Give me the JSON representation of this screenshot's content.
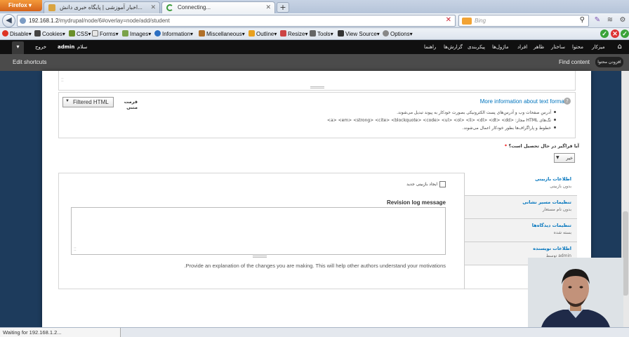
{
  "browser": {
    "app_button": "Firefox",
    "tabs": [
      {
        "label": "اخبار آموزشی | پایگاه خبری دانش...",
        "active": false
      },
      {
        "label": "Connecting...",
        "active": true
      }
    ],
    "url_host": "192.168.1.2",
    "url_path": "/mydrupal/node/6#overlay=node/add/student",
    "search_placeholder": "Bing",
    "status": "Waiting for 192.168.1.2..."
  },
  "devbar": {
    "items": [
      "Disable",
      "Cookies",
      "CSS",
      "Forms",
      "Images",
      "Information",
      "Miscellaneous",
      "Outline",
      "Resize",
      "Tools",
      "View Source",
      "Options"
    ]
  },
  "drupal": {
    "menu": [
      "میزکار",
      "محتوا",
      "ساختار",
      "ظاهر",
      "افراد",
      "ماژول‌ها",
      "پیکربندی",
      "گزارش‌ها",
      "راهنما"
    ],
    "user_greeting": "سلام",
    "user_name": "admin",
    "logout": "خروج",
    "edit_shortcuts": "Edit shortcuts",
    "find_content": "Find content",
    "add_content": "افزودن محتوا"
  },
  "form": {
    "format_label": "قرمت متنی",
    "format_value": "Filtered HTML",
    "more_info": "More information about text formats",
    "tips": [
      "آدرس صفحات وب و آدرس‌های پست الکترونیکی بصورت خودکار به پیوند تبدیل می‌شوند.",
      "تگ‌های HTML مجاز: <a> <em> <strong> <cite> <blockquote> <code> <ul> <ol> <li> <dl> <dt> <dd>",
      "خطوط و پاراگراف‌ها بطور خودکار اعمال می‌شوند."
    ],
    "question_label": "آیا فراگیر در حال تحصیل است؟",
    "question_required": "*",
    "question_value": "خیر",
    "vertical_tabs": [
      {
        "title": "اطلاعات بازبینی",
        "summary": "بدون بازبینی"
      },
      {
        "title": "تنظیمات مسیر نشانی",
        "summary": "بدون نام مستعار"
      },
      {
        "title": "تنظیمات دیدگاه‌ها",
        "summary": "بسته شده"
      },
      {
        "title": "اطلاعات نویسنده",
        "summary": "توسط admin"
      }
    ],
    "revision_checkbox_label": "ایجاد بازبینی جدید",
    "revision_title": "Revision log message",
    "revision_description": "Provide an explanation of the changes you are making. This will help other authors understand your motivations."
  }
}
